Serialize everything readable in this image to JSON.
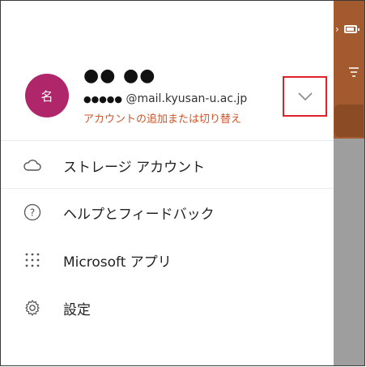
{
  "account": {
    "avatar_initial": "名",
    "name_masked": "●● ●●",
    "email_mask": "●●●●●",
    "email_domain": " @mail.kyusan-u.ac.jp",
    "switch_label": "アカウントの追加または切り替え",
    "expand_icon": "chevron-down-icon"
  },
  "menu": {
    "items": [
      {
        "label": "ストレージ アカウント",
        "icon": "cloud-icon"
      },
      {
        "label": "ヘルプとフィードバック",
        "icon": "help-circle-icon"
      },
      {
        "label": "Microsoft アプリ",
        "icon": "app-grid-icon"
      },
      {
        "label": "設定",
        "icon": "gear-icon"
      }
    ]
  },
  "colors": {
    "avatar": "#b0266b",
    "link": "#d2542a",
    "highlight_box": "#e0202a",
    "app_header": "#a35a2e"
  }
}
